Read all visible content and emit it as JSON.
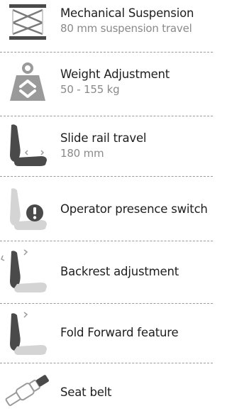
{
  "features": [
    {
      "icon": "scissor-lift-suspension-icon",
      "title": "Mechanical Suspension",
      "subtitle": "80 mm suspension travel"
    },
    {
      "icon": "weight-adjustment-icon",
      "title": "Weight Adjustment",
      "subtitle": "50 - 155 kg"
    },
    {
      "icon": "slide-rail-seat-icon",
      "title": "Slide rail travel",
      "subtitle": "180 mm"
    },
    {
      "icon": "operator-presence-switch-icon",
      "title": "Operator presence switch",
      "subtitle": ""
    },
    {
      "icon": "backrest-adjustment-icon",
      "title": "Backrest adjustment",
      "subtitle": ""
    },
    {
      "icon": "fold-forward-seat-icon",
      "title": "Fold Forward feature",
      "subtitle": ""
    },
    {
      "icon": "seat-belt-buckle-icon",
      "title": "Seat belt",
      "subtitle": ""
    }
  ],
  "colors": {
    "icon_dark": "#4a4a4a",
    "icon_light": "#d4d4d4",
    "icon_mid": "#9a9a9a",
    "title_text": "#1e1e1e",
    "subtitle_text": "#8a8a8a",
    "divider": "#9a9a9a"
  }
}
